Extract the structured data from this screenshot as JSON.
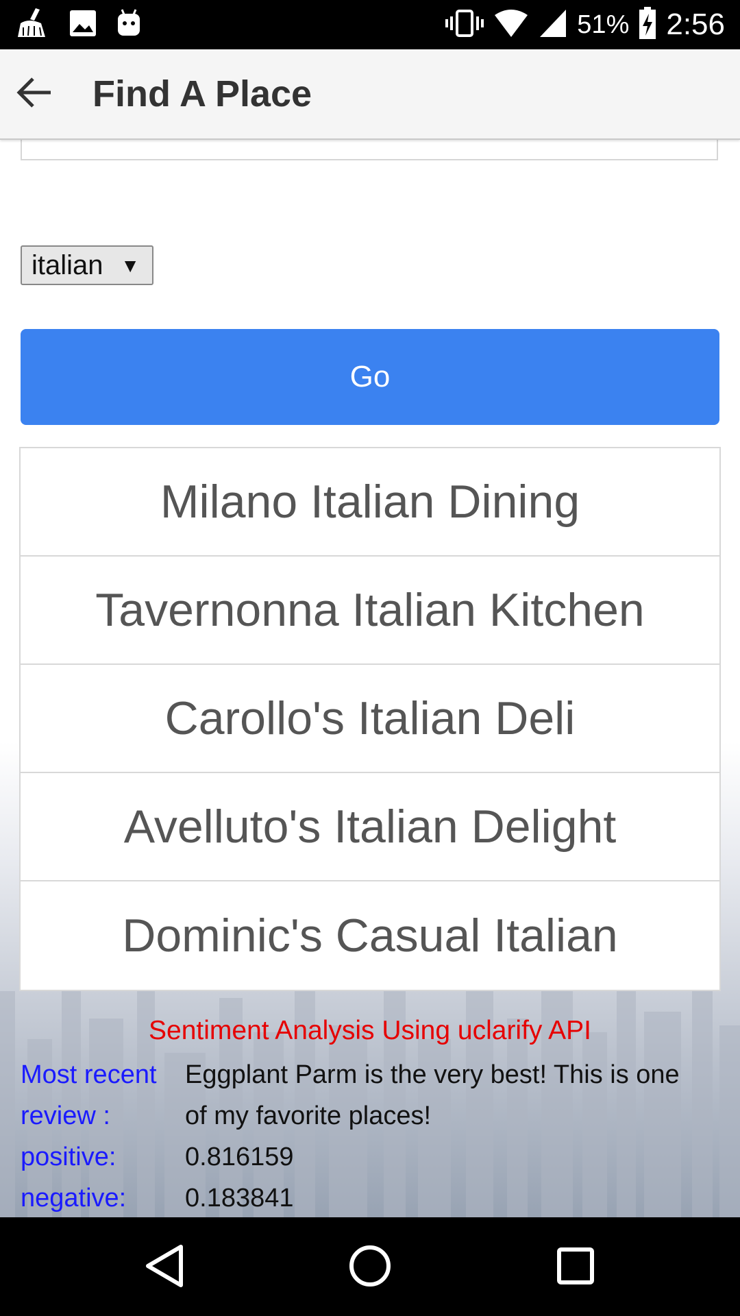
{
  "status_bar": {
    "icons_left": [
      "broom-icon",
      "image-icon",
      "android-icon"
    ],
    "icons_right": [
      "vibrate-icon",
      "wifi-icon",
      "cell-signal-icon",
      "battery-charging-icon"
    ],
    "battery": "51%",
    "time": "2:56"
  },
  "app_bar": {
    "title": "Find A Place"
  },
  "search": {
    "value": ""
  },
  "category_select": {
    "value": "italian"
  },
  "go_button": {
    "label": "Go"
  },
  "results": [
    "Milano Italian Dining",
    "Tavernonna Italian Kitchen",
    "Carollo's Italian Deli",
    "Avelluto's Italian Delight",
    "Dominic's Casual Italian"
  ],
  "sentiment": {
    "title": "Sentiment Analysis Using uclarify API",
    "review_label": "Most recent review :",
    "review_text": "Eggplant Parm is the very best! This is one of my favorite places!",
    "positive_label": "positive:",
    "positive_value": "0.816159",
    "negative_label": "negative:",
    "negative_value": "0.183841"
  },
  "colors": {
    "accent": "#3b82f0",
    "sentiment_title": "#e60000",
    "label_blue": "#1a1aff"
  }
}
